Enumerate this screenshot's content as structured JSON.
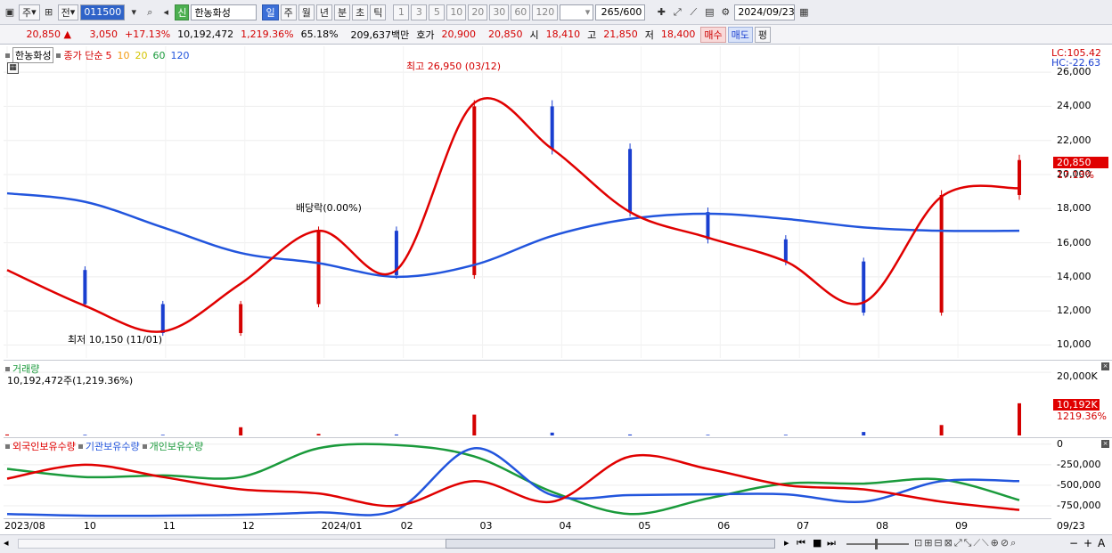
{
  "toolbar": {
    "type_label": "주",
    "mode_label": "전",
    "code": "011500",
    "stock_name": "한농화성",
    "badge": "신",
    "periods": [
      "일",
      "주",
      "월",
      "년",
      "분",
      "초",
      "틱"
    ],
    "active_period": "일",
    "intervals": [
      "1",
      "3",
      "5",
      "10",
      "20",
      "30",
      "60",
      "120"
    ],
    "count": "265",
    "count_total": "/600",
    "date": "2024/09/23"
  },
  "quote": {
    "price": "20,850",
    "arrow": "▲",
    "change": "3,050",
    "change_pct": "+17.13%",
    "volume": "10,192,472",
    "vol_ratio": "1,219.36%",
    "turnover": "65.18%",
    "amount": "209,637백만",
    "bid_label": "호가",
    "bid1": "20,900",
    "bid2": "20,850",
    "open_label": "시",
    "open": "18,410",
    "high_label": "고",
    "high": "21,850",
    "low_label": "저",
    "low": "18,400",
    "buy": "매수",
    "sell": "매도",
    "eval": "평"
  },
  "price_panel": {
    "stock_label": "한농화성",
    "ma_label": "종가 단순",
    "ma_periods": [
      "5",
      "10",
      "20",
      "60",
      "120"
    ],
    "ma_colors": [
      "#e00000",
      "#f39c12",
      "#f5e400",
      "#1a9a3b",
      "#2255dd"
    ],
    "lc": "LC:105.42",
    "hc": "HC:-22.63",
    "high_note": "최고 26,950 (03/12)",
    "low_note": "최저 10,150 (11/01)",
    "dividend_note": "배당락(0.00%)",
    "last_price_tag": "20,850",
    "last_pct_tag": "17.13%",
    "y_ticks": [
      "26,000",
      "24,000",
      "22,000",
      "20,000",
      "18,000",
      "16,000",
      "14,000",
      "12,000",
      "10,000"
    ]
  },
  "volume_panel": {
    "title": "거래량",
    "value": "10,192,472주(1,219.36%)",
    "tick": "20,000K",
    "tag_value": "10,192K",
    "tag_pct": "1219.36%"
  },
  "holding_panel": {
    "series": [
      "외국인보유수량",
      "기관보유수량",
      "개인보유수량"
    ],
    "colors": [
      "#e00000",
      "#2255dd",
      "#1a9a3b"
    ],
    "y_ticks": [
      "0",
      "-250,000",
      "-500,000",
      "-750,000"
    ]
  },
  "x_axis": {
    "labels": [
      "2023/08",
      "10",
      "11",
      "12",
      "2024/01",
      "02",
      "03",
      "04",
      "05",
      "06",
      "07",
      "08",
      "09"
    ],
    "right_label": "09/23"
  },
  "chart_data": {
    "type": "candlestick",
    "title": "한농화성",
    "x": [
      "2023/08",
      "10",
      "11",
      "12",
      "2024/01",
      "02",
      "03",
      "04",
      "05",
      "06",
      "07",
      "08",
      "09",
      "09/23"
    ],
    "close": [
      14400,
      12400,
      10700,
      12400,
      16700,
      14100,
      24000,
      21500,
      17800,
      16200,
      14900,
      11900,
      18800,
      20850
    ],
    "ma5": [
      14400,
      12300,
      10800,
      13600,
      16700,
      14400,
      24200,
      21500,
      17800,
      16300,
      14900,
      12500,
      18700,
      19200
    ],
    "ma120": [
      18900,
      18400,
      16900,
      15400,
      14800,
      14000,
      14700,
      16400,
      17400,
      17700,
      17400,
      16900,
      16700,
      16700
    ],
    "ylim": [
      9500,
      27000
    ],
    "volume_k": [
      300,
      200,
      200,
      2600,
      500,
      300,
      6600,
      900,
      300,
      200,
      200,
      1100,
      3300,
      10192
    ],
    "foreign_holding": [
      -420000,
      -250000,
      -400000,
      -550000,
      -600000,
      -750000,
      -450000,
      -700000,
      -150000,
      -300000,
      -500000,
      -550000,
      -700000,
      -800000
    ],
    "institution_holding": [
      -850000,
      -870000,
      -870000,
      -860000,
      -830000,
      -800000,
      -50000,
      -620000,
      -620000,
      -610000,
      -610000,
      -700000,
      -450000,
      -450000
    ],
    "individual_holding": [
      -300000,
      -400000,
      -380000,
      -400000,
      -50000,
      -10000,
      -150000,
      -580000,
      -850000,
      -660000,
      -480000,
      -480000,
      -430000,
      -680000
    ],
    "holding_ylim": [
      -880000,
      30000
    ]
  }
}
